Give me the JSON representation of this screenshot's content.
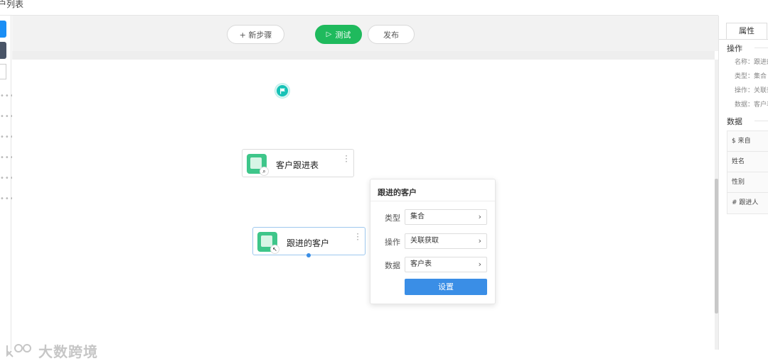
{
  "page": {
    "title": "户列表"
  },
  "toolbar": {
    "add_step": "+ 新步骤",
    "test": "测试",
    "publish": "发布"
  },
  "nodes": [
    {
      "label": "客户跟进表",
      "badge": "search-icon"
    },
    {
      "label": "跟进的客户",
      "badge": "cursor-icon"
    }
  ],
  "popover": {
    "title": "跟进的客户",
    "rows": [
      {
        "label": "类型",
        "value": "集合"
      },
      {
        "label": "操作",
        "value": "关联获取"
      },
      {
        "label": "数据",
        "value": "客户表"
      }
    ],
    "button": "设置"
  },
  "right_panel": {
    "tab": "属性",
    "ops_title": "操作",
    "props": [
      "名称：跟进的",
      "类型：集合",
      "操作：关联获",
      "数据：客户表"
    ],
    "data_title": "数据",
    "fields": [
      "$ 来自",
      "姓名",
      "性别",
      "# 跟进人"
    ]
  },
  "watermark": "大数跨境",
  "colors": {
    "green": "#1fba5d",
    "blue": "#3a8ee6",
    "teal": "#16c2b6",
    "node_icon": "#3ec68a"
  }
}
